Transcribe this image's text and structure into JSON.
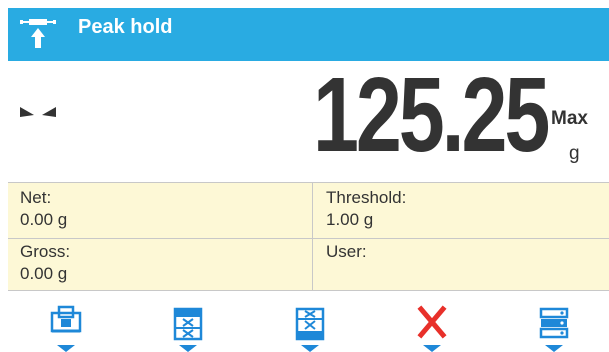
{
  "header": {
    "title": "Peak hold",
    "icon": "peak-hold-icon"
  },
  "display": {
    "stable_icon": "stable-indicator-icon",
    "value": "125.25",
    "mode": "Max",
    "unit": "g"
  },
  "info": {
    "net_label": "Net:",
    "net_value": "0.00 g",
    "gross_label": "Gross:",
    "gross_value": "0.00 g",
    "threshold_label": "Threshold:",
    "threshold_value": "1.00 g",
    "user_label": "User:",
    "user_value": ""
  },
  "function_keys": [
    {
      "icon": "tare-icon"
    },
    {
      "icon": "database-record-icon"
    },
    {
      "icon": "database-record-select-icon"
    },
    {
      "icon": "close-icon"
    },
    {
      "icon": "server-database-icon"
    }
  ],
  "colors": {
    "title_bar": "#29abe2",
    "info_panel": "#fdf8d6",
    "icon_blue": "#1e88d8",
    "close_red": "#e8302a"
  }
}
